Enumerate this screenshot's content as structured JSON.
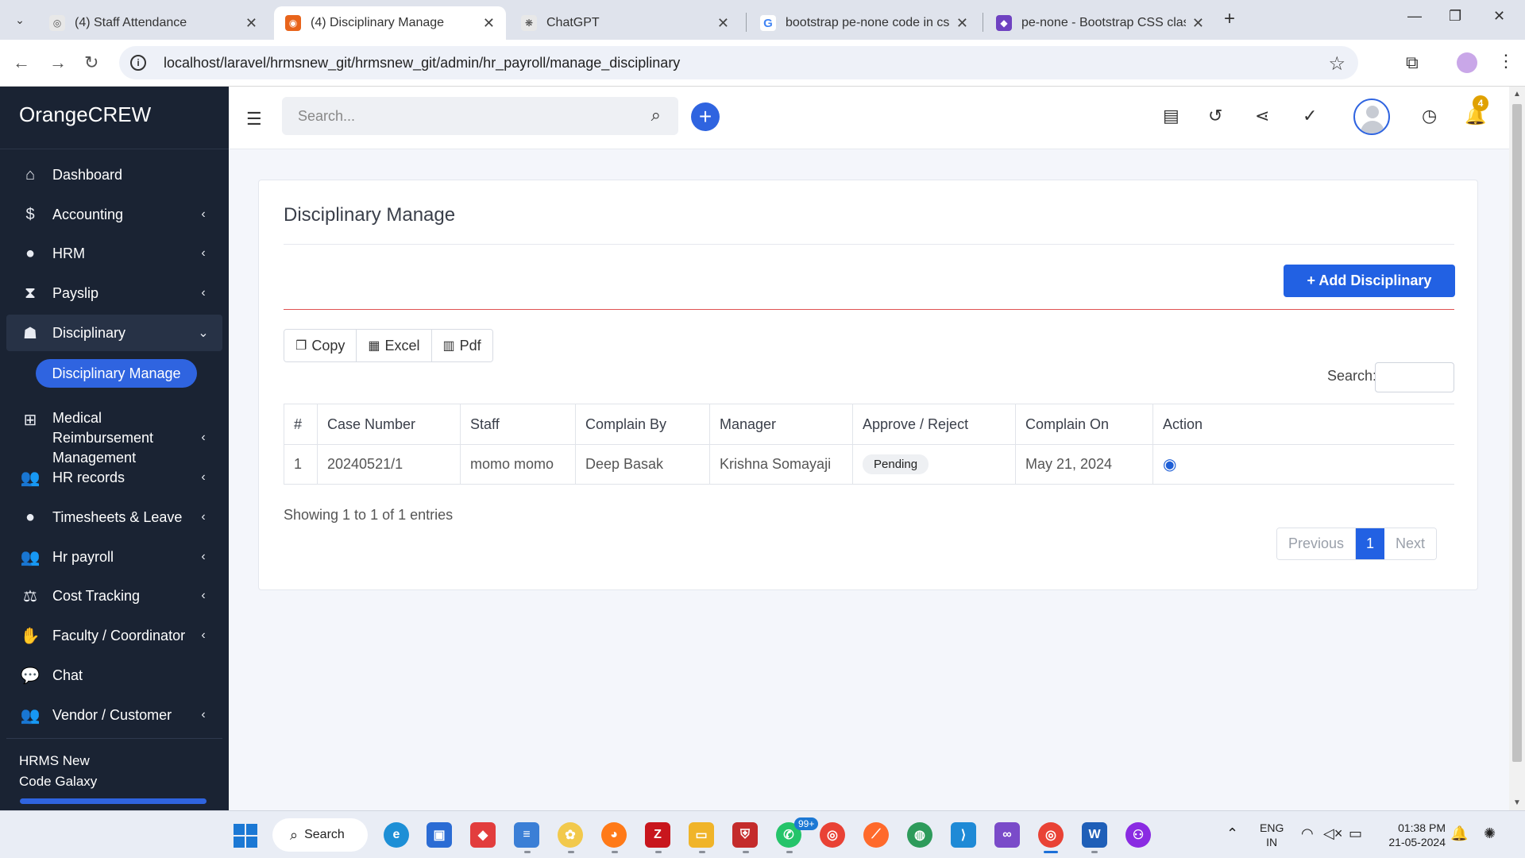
{
  "browser": {
    "tabs": [
      {
        "title": "(4) Staff Attendance",
        "active": false,
        "favicon_color": "#e8e8e8"
      },
      {
        "title": "(4) Disciplinary Manage",
        "active": true,
        "favicon_color": "#e8641b"
      },
      {
        "title": "ChatGPT",
        "active": false,
        "favicon_color": "#e8e8e8"
      },
      {
        "title": "bootstrap pe-none code in css",
        "active": false,
        "favicon_color": "#ffffff"
      },
      {
        "title": "pe-none - Bootstrap CSS class",
        "active": false,
        "favicon_color": "#6f42c1"
      }
    ],
    "url": "localhost/laravel/hrmsnew_git/hrmsnew_git/admin/hr_payroll/manage_disciplinary"
  },
  "sidebar": {
    "brand": "OrangeCREW",
    "items": [
      {
        "label": "Dashboard",
        "icon": "home-icon",
        "has_chevron": false
      },
      {
        "label": "Accounting",
        "icon": "dollar-icon",
        "has_chevron": true
      },
      {
        "label": "HRM",
        "icon": "user-circle-icon",
        "has_chevron": true
      },
      {
        "label": "Payslip",
        "icon": "hourglass-icon",
        "has_chevron": true
      },
      {
        "label": "Disciplinary",
        "icon": "sitemap-icon",
        "has_chevron": true,
        "open": true
      },
      {
        "label": "Medical Reimbursement Management",
        "icon": "first-aid-icon",
        "has_chevron": true
      },
      {
        "label": "HR records",
        "icon": "users-icon",
        "has_chevron": true
      },
      {
        "label": "Timesheets & Leave",
        "icon": "user-circle-icon",
        "has_chevron": true
      },
      {
        "label": "Hr payroll",
        "icon": "users-icon",
        "has_chevron": true
      },
      {
        "label": "Cost Tracking",
        "icon": "scale-icon",
        "has_chevron": true
      },
      {
        "label": "Faculty / Coordinator",
        "icon": "handshake-icon",
        "has_chevron": true
      },
      {
        "label": "Chat",
        "icon": "chat-icon",
        "has_chevron": false
      },
      {
        "label": "Vendor / Customer",
        "icon": "users-icon",
        "has_chevron": true
      }
    ],
    "submenu_active": "Disciplinary Manage",
    "footer_line1": "HRMS New",
    "footer_line2": "Code Galaxy"
  },
  "header": {
    "search_placeholder": "Search...",
    "notification_count": "4"
  },
  "page": {
    "title": "Disciplinary Manage",
    "add_button": "+ Add Disciplinary",
    "export_buttons": {
      "copy": "Copy",
      "excel": "Excel",
      "pdf": "Pdf"
    },
    "search_label": "Search:",
    "table": {
      "columns": [
        "#",
        "Case Number",
        "Staff",
        "Complain By",
        "Manager",
        "Approve / Reject",
        "Complain On",
        "Action"
      ],
      "rows": [
        {
          "num": "1",
          "case_number": "20240521/1",
          "staff": "momo momo",
          "complain_by": "Deep Basak",
          "manager": "Krishna Somayaji",
          "status": "Pending",
          "complain_on": "May 21, 2024"
        }
      ]
    },
    "info": "Showing 1 to 1 of 1 entries",
    "pagination": {
      "previous": "Previous",
      "current": "1",
      "next": "Next"
    }
  },
  "taskbar": {
    "search_label": "Search",
    "lang_line1": "ENG",
    "lang_line2": "IN",
    "time": "01:38 PM",
    "date": "21-05-2024",
    "whatsapp_badge": "99+"
  }
}
